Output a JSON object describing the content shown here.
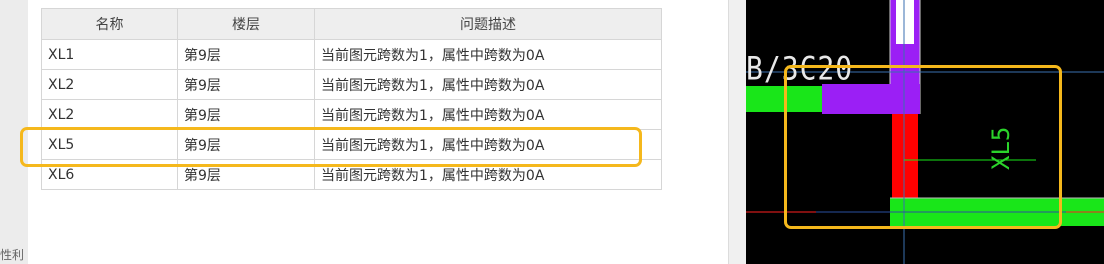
{
  "table": {
    "headers": [
      "名称",
      "楼层",
      "问题描述"
    ],
    "rows": [
      [
        "XL1",
        "第9层",
        "当前图元跨数为1，属性中跨数为0A"
      ],
      [
        "XL2",
        "第9层",
        "当前图元跨数为1，属性中跨数为0A"
      ],
      [
        "XL2",
        "第9层",
        "当前图元跨数为1，属性中跨数为0A"
      ],
      [
        "XL5",
        "第9层",
        "当前图元跨数为1，属性中跨数为0A"
      ],
      [
        "XL6",
        "第9层",
        "当前图元跨数为1，属性中跨数为0A"
      ]
    ],
    "highlighted_row": 3
  },
  "side_label": "性利",
  "cad": {
    "dimension_text": "B/3C20",
    "beam_label": "XL5",
    "colors": {
      "background": "#000000",
      "beam_green": "#19e619",
      "column_purple": "#9b1ff5",
      "column_red": "#ff0000",
      "highlight": "#f5b81c"
    }
  }
}
